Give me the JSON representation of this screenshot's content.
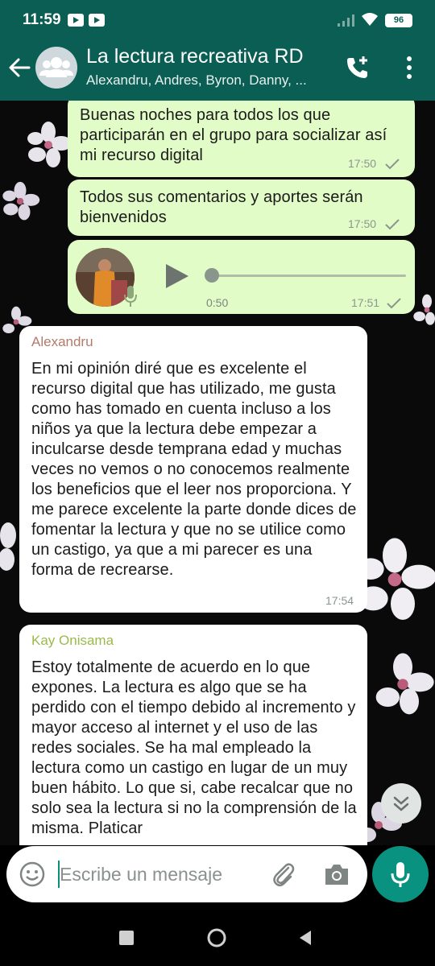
{
  "status_bar": {
    "time": "11:59",
    "battery": "96"
  },
  "header": {
    "title": "La lectura recreativa RD",
    "subtitle": "Alexandru, Andres, Byron, Danny, ..."
  },
  "messages": [
    {
      "direction": "outgoing",
      "type": "text",
      "text": "Buenas noches para todos los que participarán en el grupo para socializar así mi recurso digital",
      "time": "17:50"
    },
    {
      "direction": "outgoing",
      "type": "text",
      "text": "Todos sus comentarios y aportes serán bienvenidos",
      "time": "17:50"
    },
    {
      "direction": "outgoing",
      "type": "voice",
      "duration": "0:50",
      "time": "17:51",
      "progress": 0
    },
    {
      "direction": "incoming",
      "type": "text",
      "sender": "Alexandru",
      "sender_color": "#b57b6a",
      "text": "En mi opinión diré que es excelente el recurso digital que has utilizado, me gusta como has tomado en cuenta incluso a los niños ya que la lectura debe empezar a inculcarse desde temprana edad y muchas veces no vemos o no conocemos realmente los beneficios que el leer nos proporciona. Y me parece excelente la parte donde dices de fomentar la lectura y que no se utilice como un castigo, ya que a mi parecer es una forma de recrearse.",
      "time": "17:54"
    },
    {
      "direction": "incoming",
      "type": "text",
      "sender": "Kay Onisama",
      "sender_color": "#9aba4a",
      "text": "Estoy totalmente de acuerdo en lo que expones. La lectura es algo que se ha perdido con el tiempo debido al incremento y mayor acceso al internet y el uso de las redes sociales. Se ha mal empleado la lectura como un castigo en lugar de un muy buen hábito. Lo que si, cabe recalcar que no solo sea la lectura si no la comprensión de la misma. Platicar"
    }
  ],
  "input": {
    "placeholder": "Escribe un mensaje"
  },
  "colors": {
    "header": "#0b5e54",
    "outgoing_bubble": "#e2fcc7",
    "incoming_bubble": "#ffffff",
    "accent": "#0a9281"
  },
  "icons": [
    "back-arrow-icon",
    "group-avatar-icon",
    "add-call-icon",
    "more-vert-icon",
    "play-icon",
    "mic-icon",
    "double-chevron-down-icon",
    "emoji-icon",
    "attach-icon",
    "camera-icon",
    "check-icon"
  ]
}
